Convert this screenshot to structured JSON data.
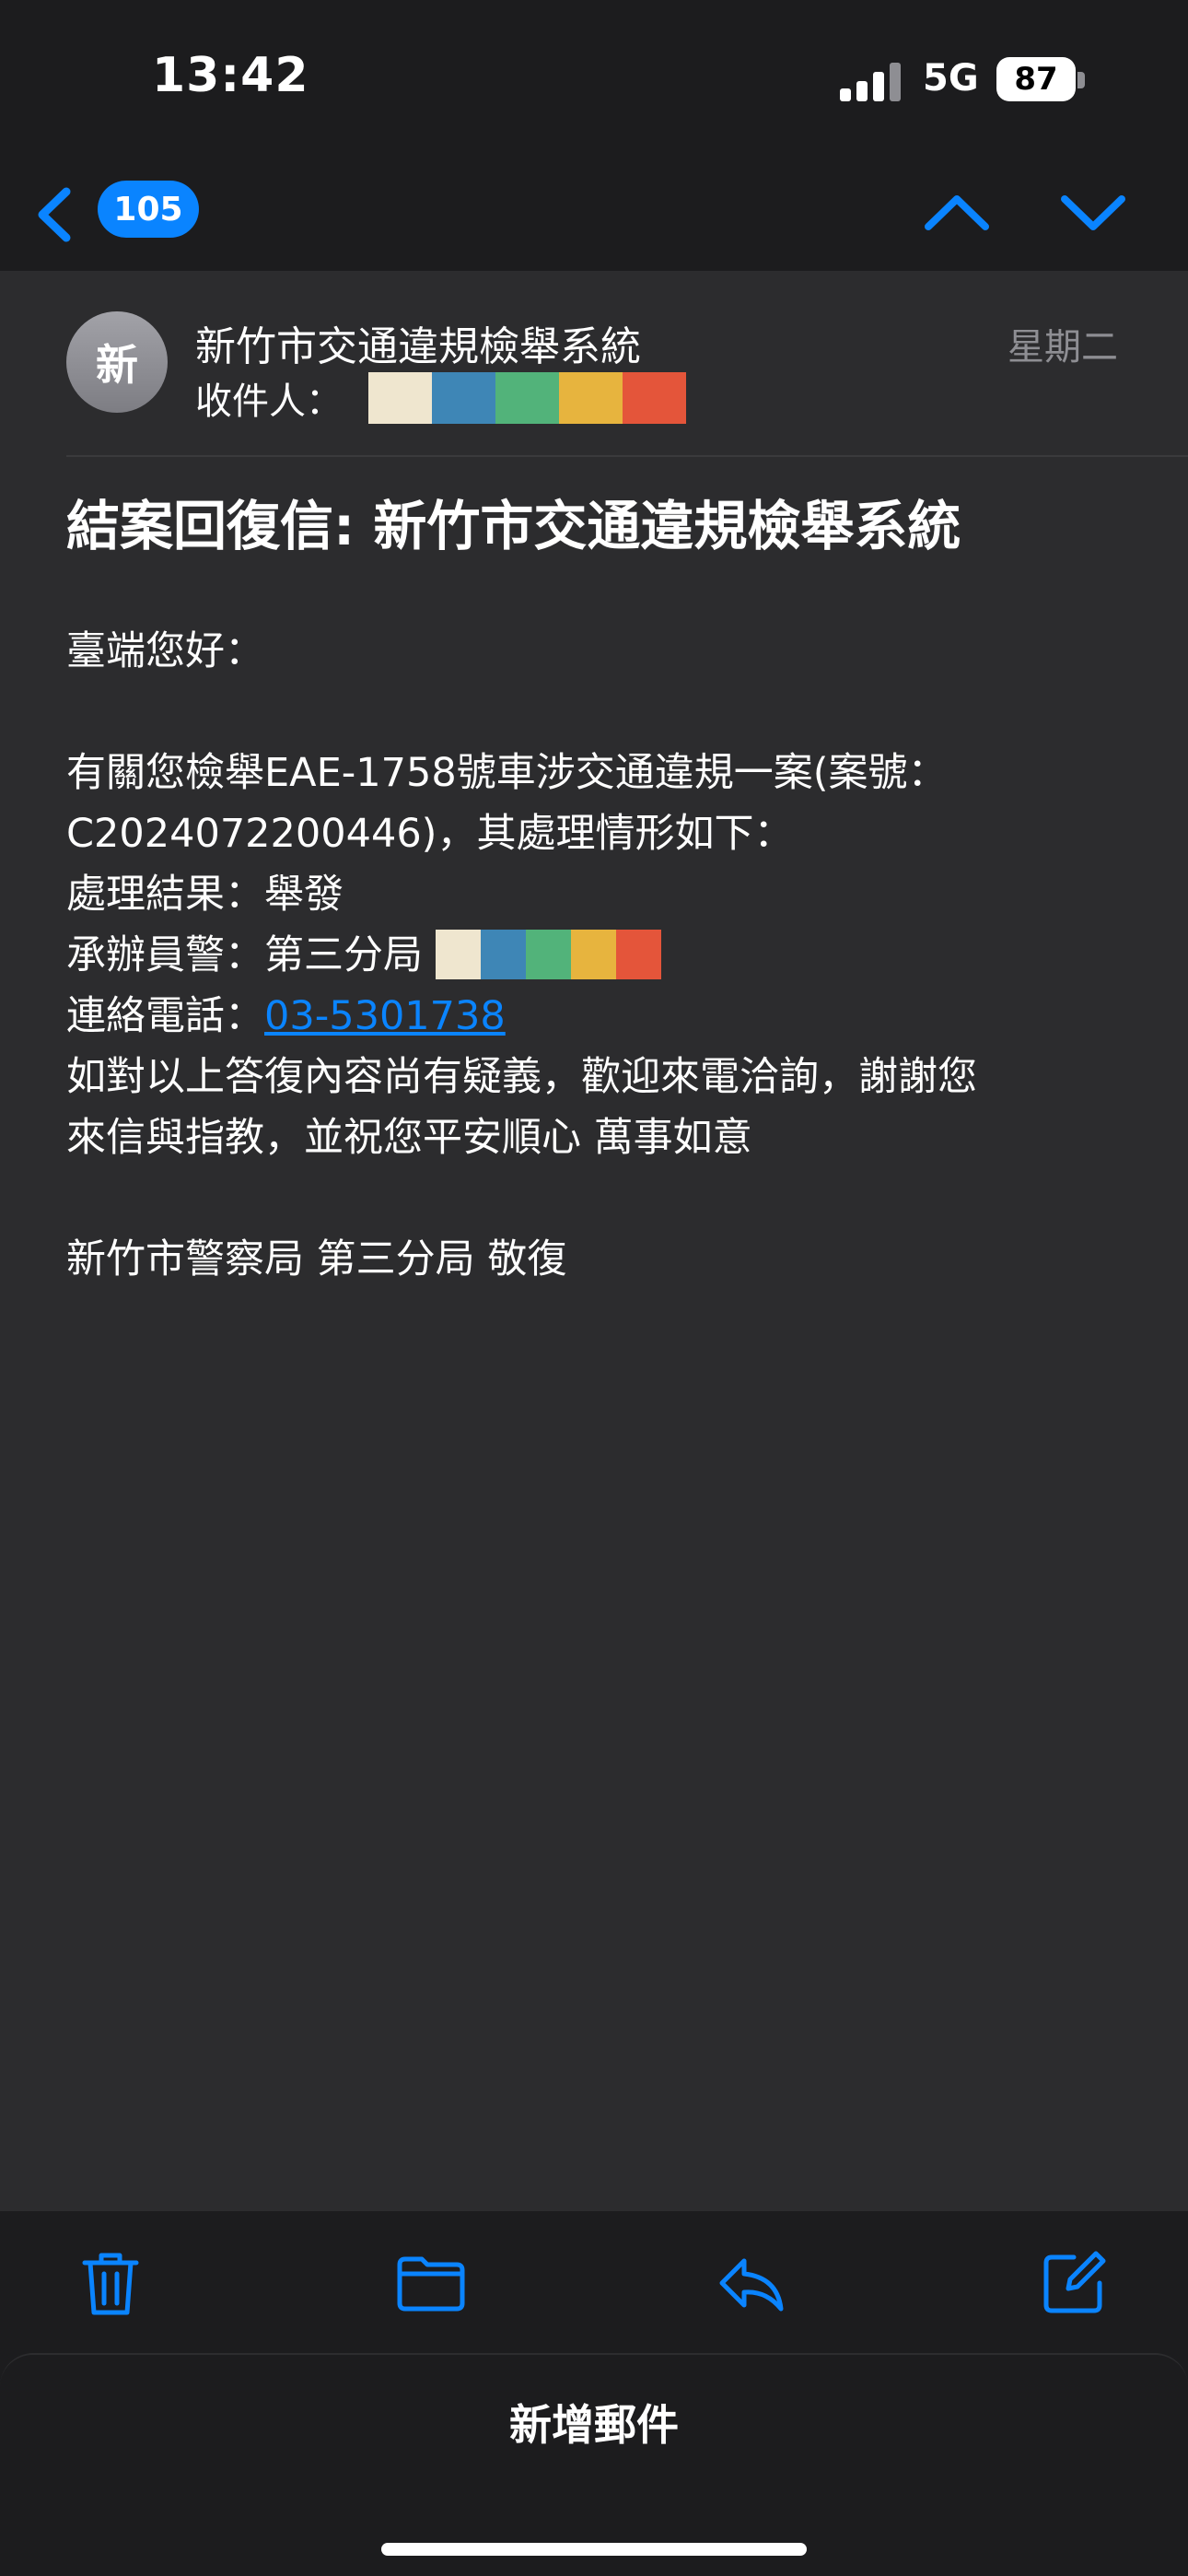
{
  "status_bar": {
    "time": "13:42",
    "network": "5G",
    "battery": "87"
  },
  "nav": {
    "unread_count": "105",
    "icons": [
      "chevron-left-icon",
      "chevron-up-icon",
      "chevron-down-icon"
    ]
  },
  "message": {
    "avatar_initial": "新",
    "sender": "新竹市交通違規檢舉系統",
    "recipient_label": "收件人：",
    "date": "星期二",
    "subject": "結案回復信: 新竹市交通違規檢舉系統",
    "body": {
      "greeting": "臺端您好：",
      "line1": "有關您檢舉EAE-1758號車涉交通違規一案(案號：",
      "line2": "C2024072200446)，其處理情形如下：",
      "result": "處理結果：舉發",
      "officer": "承辦員警：第三分局",
      "phone_label": "連絡電話：",
      "phone": "03-5301738",
      "closing1": "如對以上答復內容尚有疑義，歡迎來電洽詢，謝謝您",
      "closing2": "來信與指教，並祝您平安順心 萬事如意",
      "signature": "新竹市警察局 第三分局 敬復"
    }
  },
  "redaction_colors": [
    "#efe6cf",
    "#3e86b6",
    "#52b37a",
    "#e7b43e",
    "#e4553a"
  ],
  "toolbar": {
    "icons": [
      "trash-icon",
      "folder-icon",
      "reply-icon",
      "compose-icon"
    ]
  },
  "new_mail": {
    "label": "新增郵件"
  },
  "colors": {
    "accent": "#0a84ff",
    "background": "#2c2c2e",
    "bars": "#1c1c1e"
  }
}
